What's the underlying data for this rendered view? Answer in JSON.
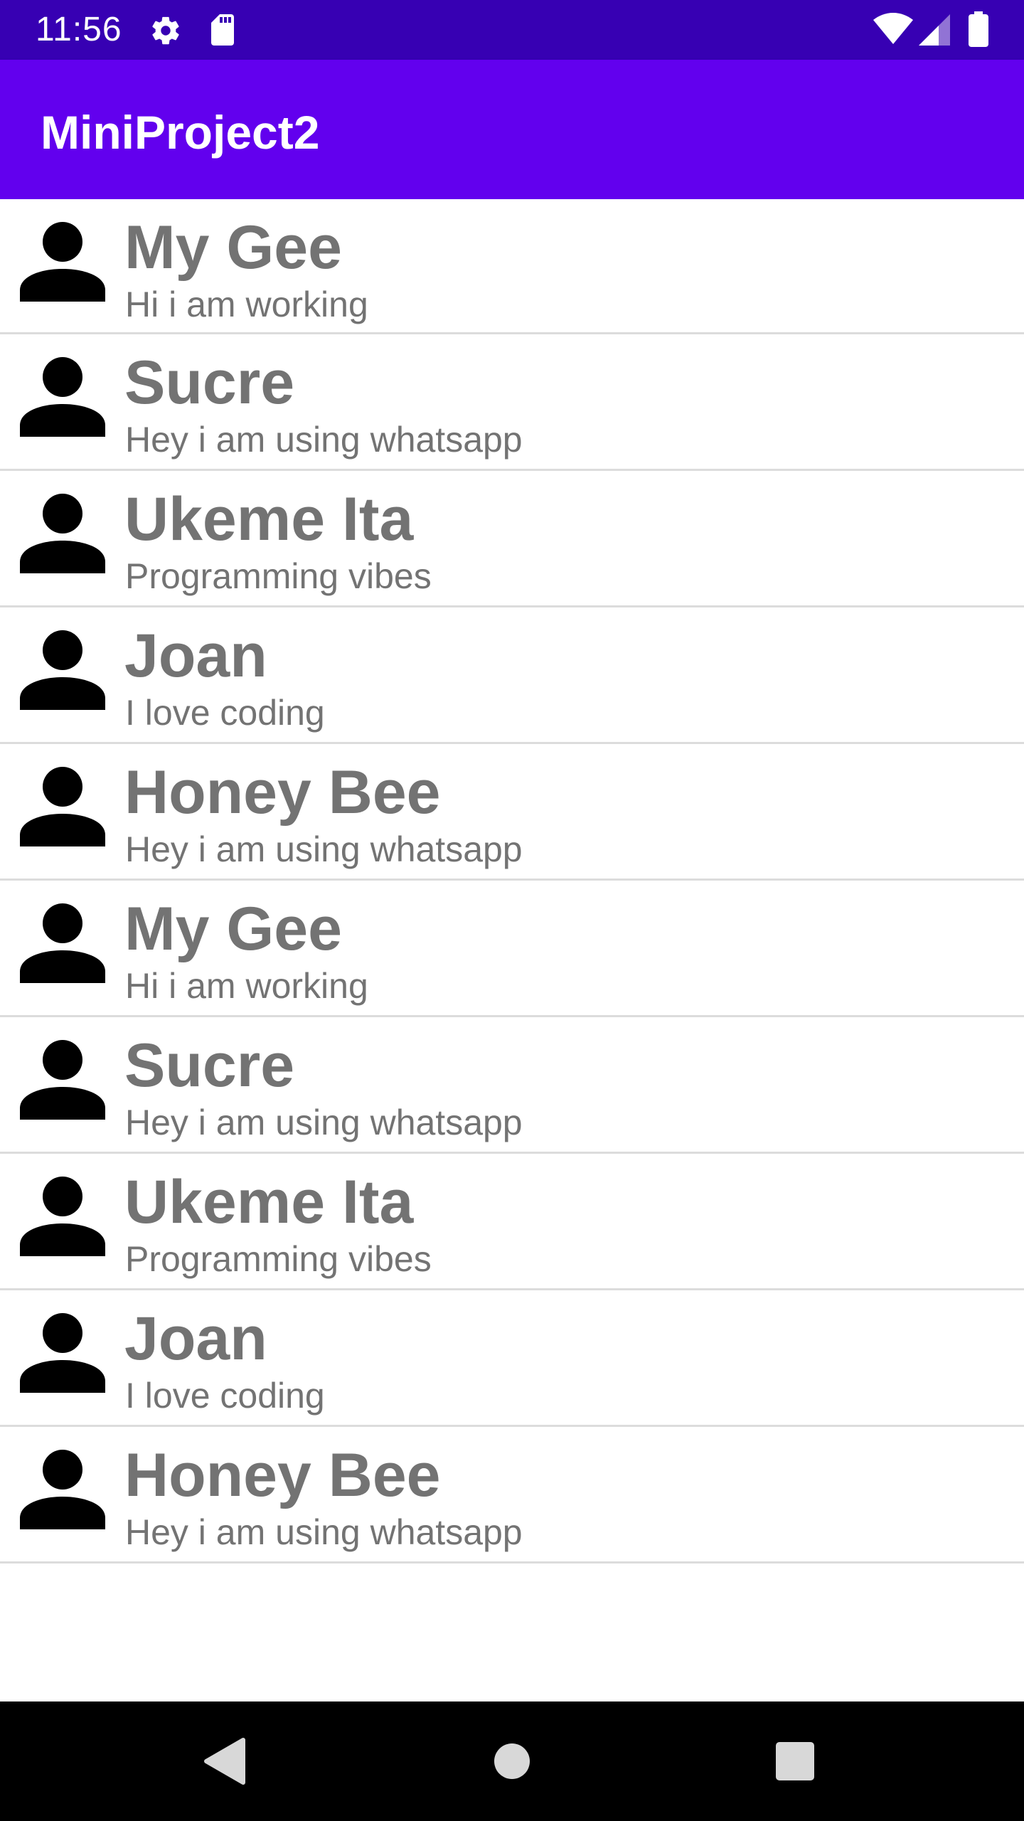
{
  "status_bar": {
    "time": "11:56",
    "icons_left": [
      "gear-icon",
      "sd-card-icon"
    ],
    "icons_right": [
      "wifi-icon",
      "signal-icon",
      "battery-icon"
    ],
    "background_color": "#3700b3"
  },
  "app_bar": {
    "title": "MiniProject2",
    "background_color": "#6200ee"
  },
  "contacts": [
    {
      "name": "My Gee",
      "status": "Hi i am working"
    },
    {
      "name": "Sucre",
      "status": "Hey i am using whatsapp"
    },
    {
      "name": "Ukeme Ita",
      "status": "Programming vibes"
    },
    {
      "name": "Joan",
      "status": "I love coding"
    },
    {
      "name": "Honey Bee",
      "status": "Hey i am using whatsapp"
    },
    {
      "name": "My Gee",
      "status": "Hi i am working"
    },
    {
      "name": "Sucre",
      "status": "Hey i am using whatsapp"
    },
    {
      "name": "Ukeme Ita",
      "status": "Programming vibes"
    },
    {
      "name": "Joan",
      "status": "I love coding"
    },
    {
      "name": "Honey Bee",
      "status": "Hey i am using whatsapp"
    }
  ],
  "contact_avatar_icon": "person-icon",
  "nav_bar": {
    "buttons": [
      "back-triangle-icon",
      "home-circle-icon",
      "recents-square-icon"
    ]
  }
}
